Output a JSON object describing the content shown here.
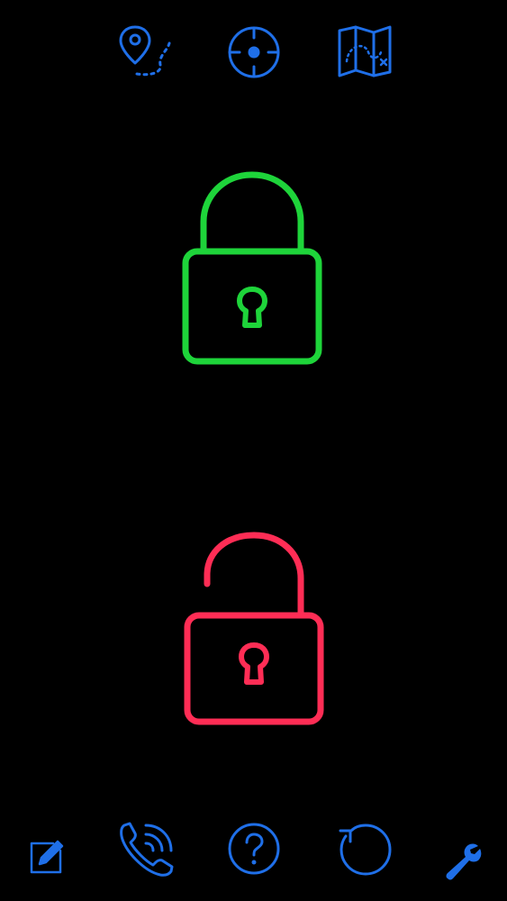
{
  "colors": {
    "background": "#000000",
    "toolbar_icon": "#1f6fe8",
    "locked": "#1ed43a",
    "unlocked": "#ff2d55"
  },
  "top_toolbar": [
    {
      "icon": "location-route-icon"
    },
    {
      "icon": "crosshair-icon"
    },
    {
      "icon": "treasure-map-icon"
    }
  ],
  "locks": [
    {
      "icon": "locked-padlock-icon",
      "state": "locked"
    },
    {
      "icon": "unlocked-padlock-icon",
      "state": "unlocked"
    }
  ],
  "bottom_toolbar": [
    {
      "icon": "edit-note-icon"
    },
    {
      "icon": "phone-call-icon"
    },
    {
      "icon": "help-icon"
    },
    {
      "icon": "reset-icon"
    },
    {
      "icon": "wrench-settings-icon"
    }
  ]
}
